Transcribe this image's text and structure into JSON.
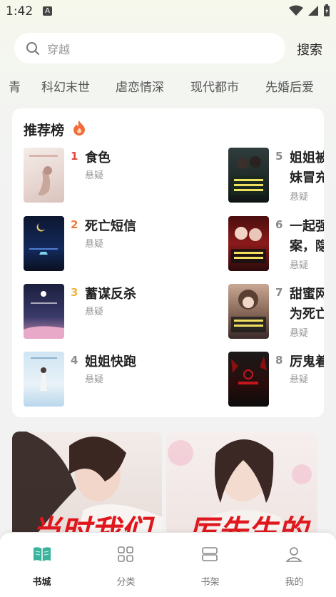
{
  "status": {
    "time": "1:42",
    "badge": "A"
  },
  "search": {
    "placeholder": "穿越",
    "button": "搜索"
  },
  "categories": [
    "青",
    "科幻末世",
    "虐恋情深",
    "现代都市",
    "先婚后爱"
  ],
  "ranking": {
    "title": "推荐榜",
    "items": [
      {
        "rank": "1",
        "title": "食色",
        "genre": "悬疑",
        "color": "#e14b3b"
      },
      {
        "rank": "2",
        "title": "死亡短信",
        "genre": "悬疑",
        "color": "#f07a3a"
      },
      {
        "rank": "3",
        "title": "蓄谋反杀",
        "genre": "悬疑",
        "color": "#f0b23a"
      },
      {
        "rank": "4",
        "title": "姐姐快跑",
        "genre": "悬疑",
        "color": "#8a8a8a"
      },
      {
        "rank": "5",
        "title_line1": "姐姐被",
        "title_line2": "妹冒充",
        "genre": "悬疑",
        "color": "#8a8a8a"
      },
      {
        "rank": "6",
        "title_line1": "一起强",
        "title_line2": "案，隐",
        "genre": "悬疑",
        "color": "#8a8a8a"
      },
      {
        "rank": "7",
        "title_line1": "甜蜜网",
        "title_line2": "为死亡",
        "genre": "悬疑",
        "color": "#8a8a8a"
      },
      {
        "rank": "8",
        "title": "厉鬼着",
        "genre": "悬疑",
        "color": "#8a8a8a"
      }
    ]
  },
  "banners": [
    {
      "text": "当时我们"
    },
    {
      "text": "厉先生的"
    }
  ],
  "nav": [
    {
      "label": "书城",
      "icon": "book-open-icon",
      "active": true
    },
    {
      "label": "分类",
      "icon": "grid-icon",
      "active": false
    },
    {
      "label": "书架",
      "icon": "bookshelf-icon",
      "active": false
    },
    {
      "label": "我的",
      "icon": "person-icon",
      "active": false
    }
  ],
  "colors": {
    "accent": "#3bb39c",
    "fire": "#f26b3a"
  }
}
